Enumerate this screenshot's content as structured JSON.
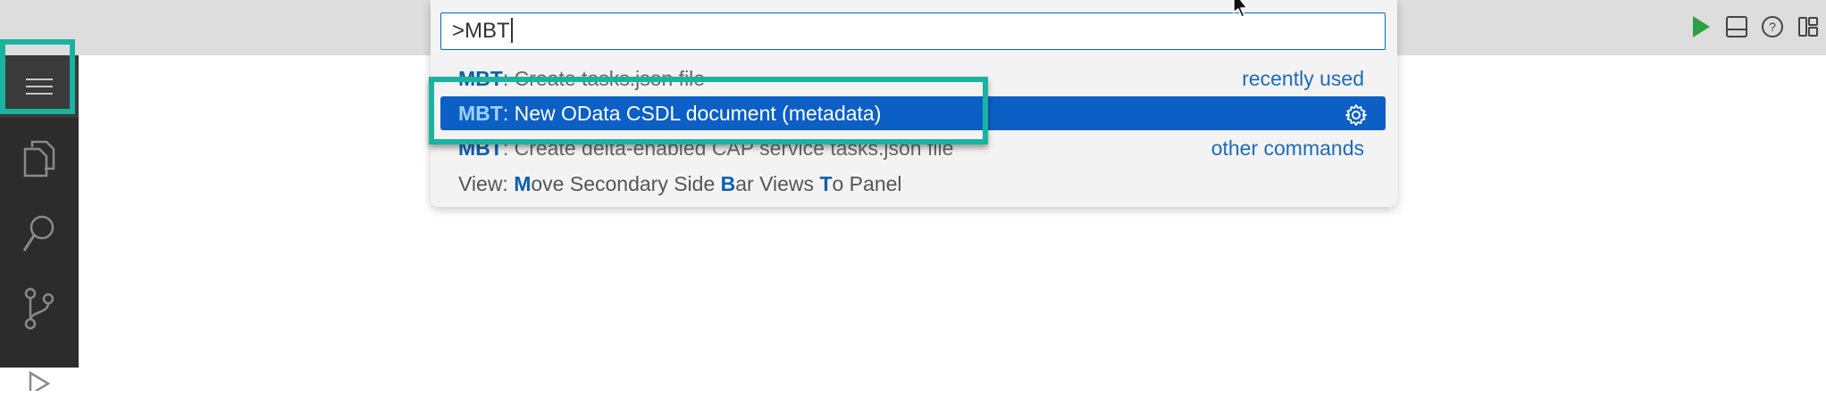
{
  "palette": {
    "input_value": ">MBT",
    "items": [
      {
        "prefix": "MBT",
        "rest_html": ": Create tasks.json file",
        "description": "recently used"
      },
      {
        "prefix": "MBT",
        "rest": ": New OData CSDL document (metadata)",
        "icon": "gear-icon"
      },
      {
        "prefix": "MBT",
        "rest": ": Create delta-enabled CAP service tasks.json file",
        "description": "other commands"
      },
      {
        "segments": [
          "View: ",
          "M",
          "ove Secondary Side ",
          "B",
          "ar Views ",
          "T",
          "o Panel"
        ]
      }
    ]
  },
  "activity_bar": {
    "items": [
      "menu-icon",
      "explorer-icon",
      "search-icon",
      "source-control-icon",
      "run-debug-icon"
    ]
  },
  "toolbar": {
    "icons": [
      "run-icon",
      "toggle-panel-icon",
      "help-icon",
      "customize-layout-icon"
    ]
  },
  "colors": {
    "accent": "#19b3a0",
    "selection": "#0c5fc4",
    "match_highlight": "#0d5fb0",
    "run_green": "#2ea043"
  }
}
